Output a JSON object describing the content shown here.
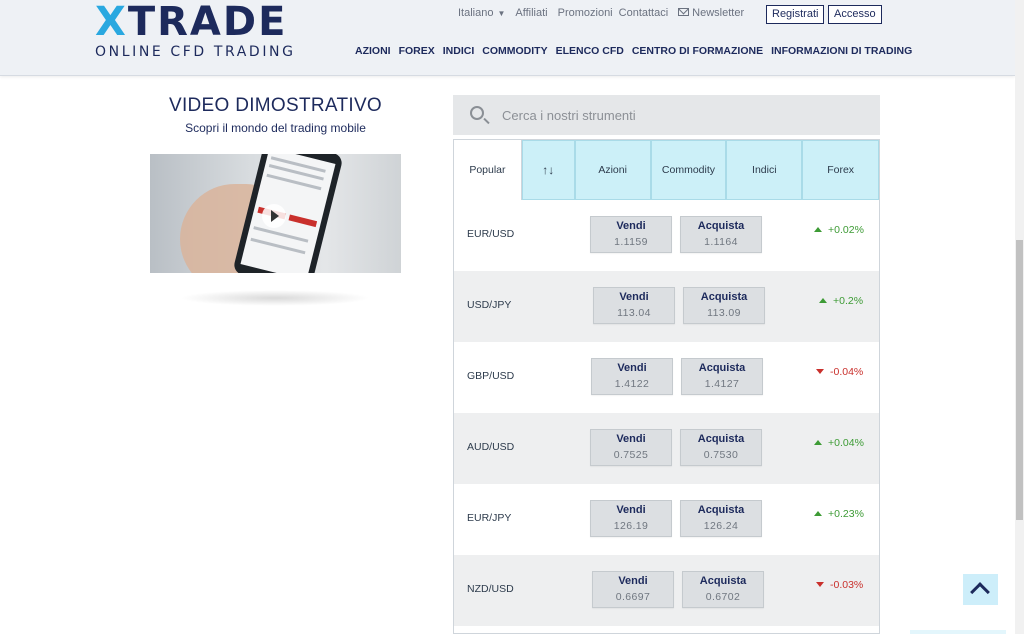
{
  "header": {
    "logo_x": "X",
    "logo_rest": "TRADE",
    "logo_sub": "ONLINE CFD TRADING",
    "language": "Italiano",
    "top_links": [
      "Affiliati",
      "Promozioni",
      "Contattaci"
    ],
    "newsletter": "Newsletter",
    "register": "Registrati",
    "login": "Accesso",
    "nav": [
      "AZIONI",
      "FOREX",
      "INDICI",
      "COMMODITY",
      "ELENCO CFD",
      "CENTRO DI FORMAZIONE",
      "INFORMAZIONI DI TRADING"
    ]
  },
  "video": {
    "title": "VIDEO DIMOSTRATIVO",
    "subtitle": "Scopri il mondo del trading mobile"
  },
  "search": {
    "placeholder": "Cerca i nostri strumenti"
  },
  "tabs": [
    "Popular",
    "↑↓",
    "Azioni",
    "Commodity",
    "Indici",
    "Forex"
  ],
  "instruments": [
    {
      "pair": "EUR/USD",
      "sell_label": "Vendi",
      "sell": "1.1159",
      "buy_label": "Acquista",
      "buy": "1.1164",
      "change": "+0.02%",
      "direction": "up"
    },
    {
      "pair": "USD/JPY",
      "sell_label": "Vendi",
      "sell": "113.04",
      "buy_label": "Acquista",
      "buy": "113.09",
      "change": "+0.2%",
      "direction": "up"
    },
    {
      "pair": "GBP/USD",
      "sell_label": "Vendi",
      "sell": "1.4122",
      "buy_label": "Acquista",
      "buy": "1.4127",
      "change": "-0.04%",
      "direction": "down"
    },
    {
      "pair": "AUD/USD",
      "sell_label": "Vendi",
      "sell": "0.7525",
      "buy_label": "Acquista",
      "buy": "0.7530",
      "change": "+0.04%",
      "direction": "up"
    },
    {
      "pair": "EUR/JPY",
      "sell_label": "Vendi",
      "sell": "126.19",
      "buy_label": "Acquista",
      "buy": "126.24",
      "change": "+0.23%",
      "direction": "up"
    },
    {
      "pair": "NZD/USD",
      "sell_label": "Vendi",
      "sell": "0.6697",
      "buy_label": "Acquista",
      "buy": "0.6702",
      "change": "-0.03%",
      "direction": "down"
    }
  ],
  "colors": {
    "brand_navy": "#1d2a5c",
    "brand_blue": "#29a8e0",
    "tab_bg": "#ccf0f8",
    "up": "#3d9b35",
    "down": "#c9302c"
  },
  "icons": {
    "search": "search-icon",
    "back_to_top": "chevron-up-icon",
    "play": "play-icon",
    "newsletter": "mail-icon"
  }
}
